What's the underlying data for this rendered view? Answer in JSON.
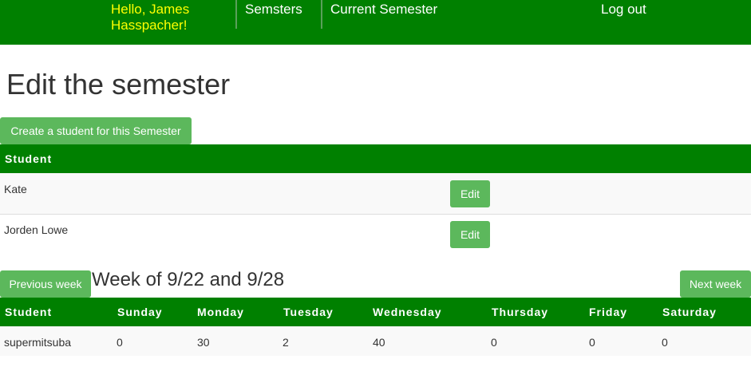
{
  "nav": {
    "greeting": "Hello, James Hasspacher!",
    "semesters": "Semsters",
    "current_semester": "Current Semester",
    "logout": "Log out"
  },
  "page_title": "Edit the semester",
  "create_student_button": "Create a student for this Semester",
  "students_table": {
    "header": "Student",
    "rows": [
      {
        "name": "Kate",
        "action": "Edit"
      },
      {
        "name": "Jorden Lowe",
        "action": "Edit"
      }
    ]
  },
  "week": {
    "title": "Week of 9/22 and 9/28",
    "prev_button": "Previous week",
    "next_button": "Next week",
    "columns": [
      "Student",
      "Sunday",
      "Monday",
      "Tuesday",
      "Wednesday",
      "Thursday",
      "Friday",
      "Saturday"
    ],
    "rows": [
      [
        "supermitsuba",
        "0",
        "30",
        "2",
        "40",
        "0",
        "0",
        "0"
      ]
    ]
  },
  "colors": {
    "nav_bg": "#008000",
    "greeting": "#ffff00",
    "button_bg": "#5cb85c",
    "row_alt": "#f9f9f9"
  }
}
